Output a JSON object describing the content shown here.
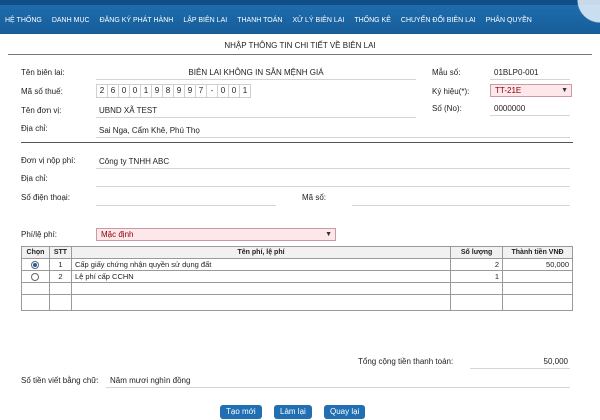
{
  "nav": [
    "HỆ THỐNG",
    "DANH MỤC",
    "ĐĂNG KÝ PHÁT HÀNH",
    "LẬP BIÊN LAI",
    "THANH TOÁN",
    "XỬ LÝ BIÊN LAI",
    "THỐNG KÊ",
    "CHUYỂN ĐỔI BIÊN LAI",
    "PHÂN QUYỀN"
  ],
  "form_title": "NHẬP THÔNG TIN CHI TIẾT VỀ BIÊN LAI",
  "receipt": {
    "name_label": "Tên biên lai:",
    "name_value": "BIÊN LAI KHÔNG IN SẴN MỆNH GIÁ",
    "form_no_label": "Mẫu số:",
    "form_no_value": "01BLP0-001",
    "tax_label": "Mã số thuế:",
    "tax_cells": [
      "2",
      "6",
      "0",
      "0",
      "1",
      "9",
      "8",
      "9",
      "9",
      "7",
      "-",
      "0",
      "0",
      "1"
    ],
    "symbol_label": "Ký hiệu(*):",
    "symbol_value": "TT-21E",
    "unit_label": "Tên đơn vị:",
    "unit_value": "UBND XÃ TEST",
    "number_label": "Số (No):",
    "number_value": "0000000",
    "address_label": "Địa chỉ:",
    "address_value": "Sai Nga, Cẩm Khê, Phú Thọ"
  },
  "payer": {
    "unit_label": "Đơn vị nộp phí:",
    "unit_value": "Công ty TNHH ABC",
    "address_label": "Địa chỉ:",
    "phone_label": "Số điện thoại:",
    "code_label": "Mã số:",
    "fee_type_label": "Phí/lệ phí:",
    "fee_type_value": "Mặc định"
  },
  "table": {
    "headers": [
      "Chọn",
      "STT",
      "Tên phí, lệ phí",
      "Số lượng",
      "Thành tiền VNĐ"
    ],
    "rows": [
      {
        "stt": "1",
        "name": "Cấp giấy chứng nhận quyền sử dụng đất",
        "qty": "2",
        "amount": "50,000"
      },
      {
        "stt": "2",
        "name": "Lệ phí cấp CCHN",
        "qty": "1",
        "amount": ""
      }
    ]
  },
  "total_label": "Tổng cộng tiền thanh toán:",
  "total_value": "50,000",
  "words_label": "Số tiền viết bằng chữ:",
  "words_value": "Năm  mươi nghìn đồng",
  "buttons": {
    "new": "Tạo mới",
    "redo": "Làm lại",
    "back": "Quay lại"
  }
}
